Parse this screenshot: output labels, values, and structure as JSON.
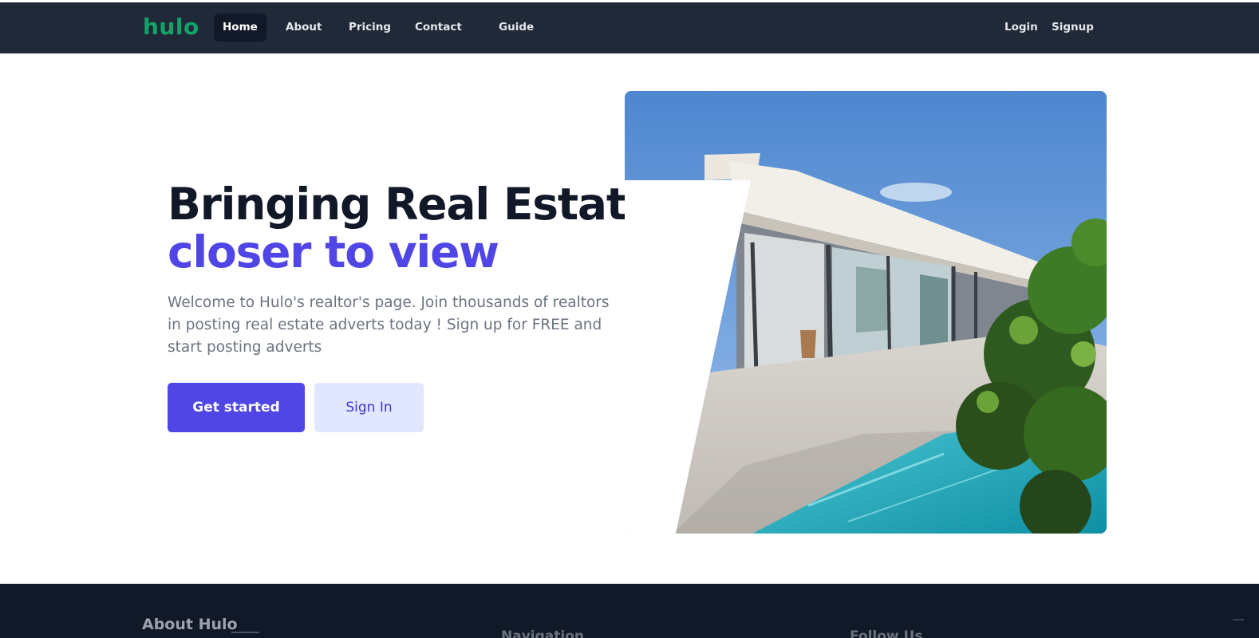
{
  "nav": {
    "logo": "hulo",
    "links": [
      {
        "label": "Home",
        "active": true
      },
      {
        "label": "About"
      },
      {
        "label": "Pricing"
      },
      {
        "label": "Contact"
      },
      {
        "label": "Guide"
      }
    ],
    "auth": {
      "login": "Login",
      "signup": "Signup"
    }
  },
  "hero": {
    "title_line1": "Bringing Real Estate",
    "title_line2": "closer to view",
    "description": "Welcome to Hulo's realtor's page. Join thousands of realtors in posting real estate adverts today ! Sign up for FREE and start posting adverts",
    "primary_button": "Get started",
    "secondary_button": "Sign In"
  },
  "footer": {
    "about_title": "About Hulo",
    "col2_title": "Navigation",
    "col3_title": "Follow Us"
  },
  "colors": {
    "nav_bg": "#1f2937",
    "logo": "#10a36a",
    "accent": "#4f46e5",
    "footer_bg": "#111827"
  }
}
